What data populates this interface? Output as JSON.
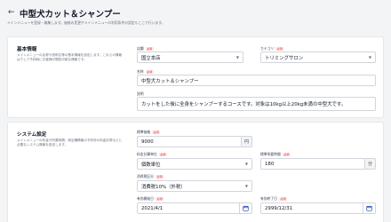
{
  "header": {
    "back_glyph": "←",
    "title": "中型犬カット＆シャンプー",
    "subtitle": "メインメニューを登録・編集します。価格の変更やメインメニューの利用条件の設定もここで行います。"
  },
  "basic": {
    "title": "基本情報",
    "description": "メインメニューの名称や説明文等の基本情報を設定します。これらの情報はウェブ予約時にお客様が閲覧可能な情報です。",
    "store_label": "店舗",
    "store_value": "国立本店",
    "category_label": "カテゴリ",
    "category_value": "トリミングサロン",
    "name_label": "名称",
    "name_value": "中型犬カット＆シャンプー",
    "desc_label": "説明",
    "desc_value": "カットをした後に全身をシャンプーするコースです。対象は10kg以上20kg未満の中型犬です。"
  },
  "system": {
    "title": "システム設定",
    "description": "メインメニューの料金や所要時間、他店舗情報の予約枠の料金計算などに必要なシステム情報を設定します。",
    "price_label": "標準価格",
    "price_value": "9000",
    "price_unit": "円",
    "calc_label": "料金計算単位",
    "calc_value": "個数単位",
    "time_label": "標準所要時間",
    "time_value": "180",
    "time_unit": "分",
    "tax_label": "消費税区分",
    "tax_value": "消費税10%（外税）",
    "start_label": "有効開始日",
    "start_value": "2021/4/1",
    "end_label": "有効終了日",
    "end_value": "2999/12/31"
  },
  "required_badge": "必須",
  "icons": {
    "back": "arrow-left-icon",
    "chevron": "chevron-down-icon",
    "calendar": "calendar-icon"
  },
  "colors": {
    "required": "#dc2626",
    "calendar_icon": "#1e40af"
  }
}
